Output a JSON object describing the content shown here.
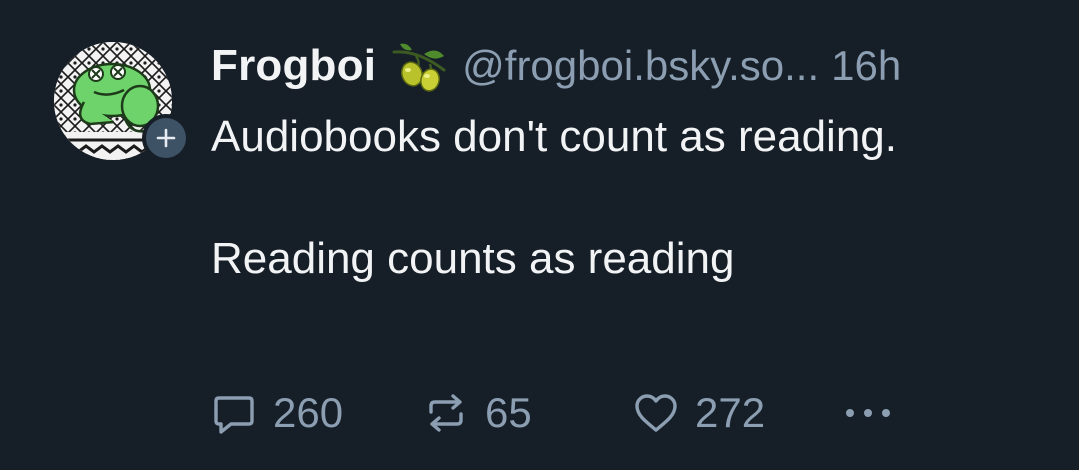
{
  "post": {
    "author": {
      "display_name": "Frogboi",
      "handle": "@frogboi.bsky.so...",
      "name_emoji": "olive-icon",
      "avatar": "frog-avatar"
    },
    "timestamp": "16h",
    "text_lines": [
      "Audiobooks don't count as reading.",
      "Reading counts as reading"
    ],
    "actions": {
      "reply": {
        "icon": "reply-bubble-icon",
        "count": "260"
      },
      "repost": {
        "icon": "repost-icon",
        "count": "65"
      },
      "like": {
        "icon": "heart-icon",
        "count": "272"
      },
      "more": {
        "icon": "more-dots-icon"
      }
    },
    "follow_badge": {
      "icon": "plus-icon"
    }
  },
  "colors": {
    "background": "#161e27",
    "primary_text": "#f1f3f5",
    "secondary_text": "#8c9eb2",
    "badge": "#3e5266"
  }
}
